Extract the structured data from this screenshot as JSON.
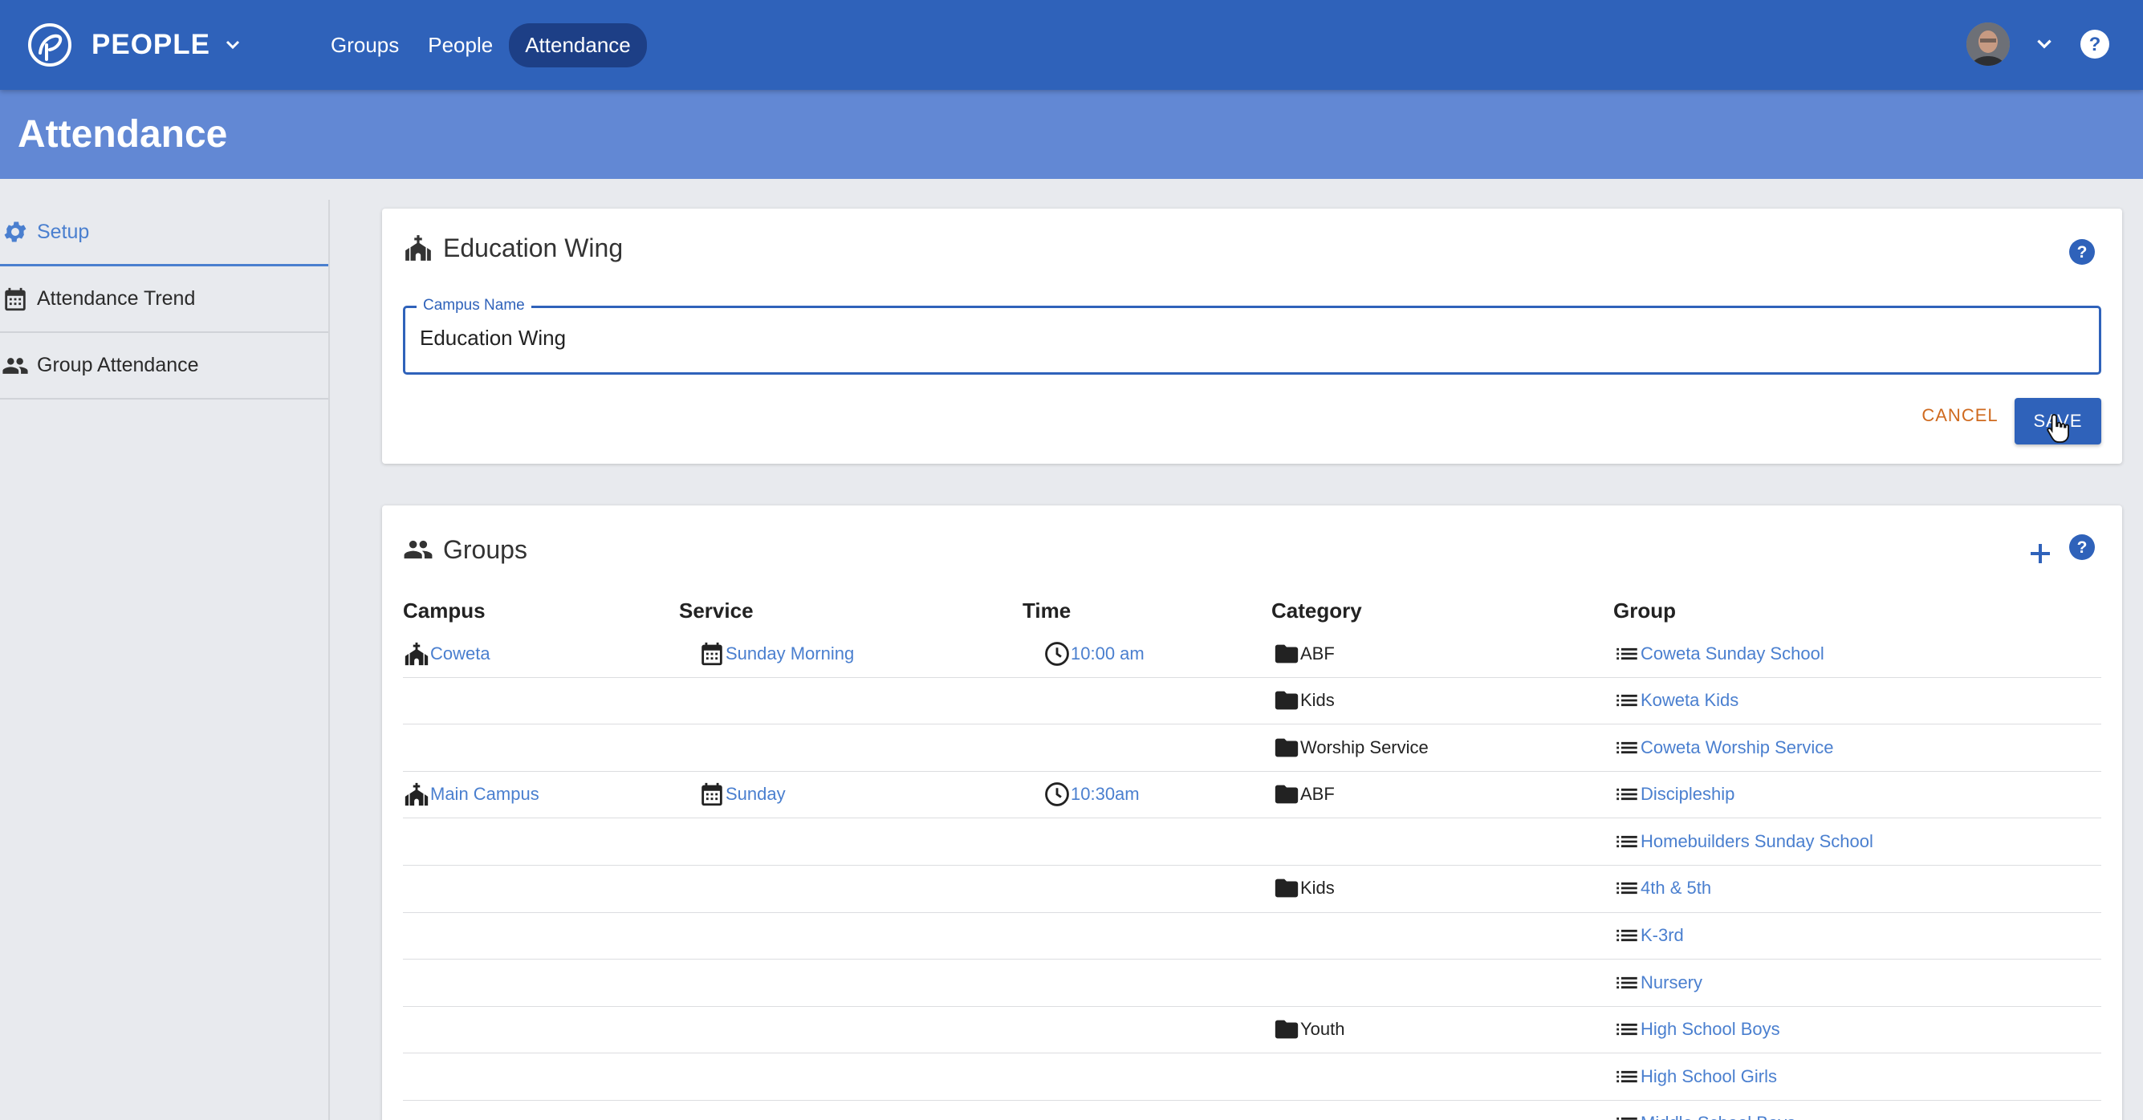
{
  "app": {
    "name": "PEOPLE"
  },
  "nav": {
    "items": [
      {
        "label": "Groups"
      },
      {
        "label": "People"
      },
      {
        "label": "Attendance",
        "active": true
      }
    ]
  },
  "page": {
    "title": "Attendance"
  },
  "sidebar": {
    "items": [
      {
        "label": "Setup",
        "icon": "gear-icon",
        "active": true
      },
      {
        "label": "Attendance Trend",
        "icon": "calendar-icon"
      },
      {
        "label": "Group Attendance",
        "icon": "people-icon"
      }
    ]
  },
  "campus_card": {
    "title": "Education Wing",
    "field_label": "Campus Name",
    "field_value": "Education Wing",
    "cancel_label": "CANCEL",
    "save_label": "SAVE"
  },
  "groups_card": {
    "title": "Groups",
    "columns": [
      "Campus",
      "Service",
      "Time",
      "Category",
      "Group"
    ],
    "rows": [
      {
        "campus": "Coweta",
        "service": "Sunday Morning",
        "time": "10:00 am",
        "category": "ABF",
        "group": "Coweta Sunday School"
      },
      {
        "campus": "",
        "service": "",
        "time": "",
        "category": "Kids",
        "group": "Koweta Kids"
      },
      {
        "campus": "",
        "service": "",
        "time": "",
        "category": "Worship Service",
        "group": "Coweta Worship Service"
      },
      {
        "campus": "Main Campus",
        "service": "Sunday",
        "time": "10:30am",
        "category": "ABF",
        "group": "Discipleship"
      },
      {
        "campus": "",
        "service": "",
        "time": "",
        "category": "",
        "group": "Homebuilders Sunday School"
      },
      {
        "campus": "",
        "service": "",
        "time": "",
        "category": "Kids",
        "group": "4th & 5th"
      },
      {
        "campus": "",
        "service": "",
        "time": "",
        "category": "",
        "group": "K-3rd"
      },
      {
        "campus": "",
        "service": "",
        "time": "",
        "category": "",
        "group": "Nursery"
      },
      {
        "campus": "",
        "service": "",
        "time": "",
        "category": "Youth",
        "group": "High School Boys"
      },
      {
        "campus": "",
        "service": "",
        "time": "",
        "category": "",
        "group": "High School Girls"
      },
      {
        "campus": "",
        "service": "",
        "time": "",
        "category": "",
        "group": "Middle School Boys"
      }
    ]
  },
  "colors": {
    "nav_bar": "#2f62ba",
    "title_band": "#6288d4",
    "link": "#4a7fcf",
    "cancel": "#cf6a1f",
    "save_button": "#2f62ba"
  }
}
